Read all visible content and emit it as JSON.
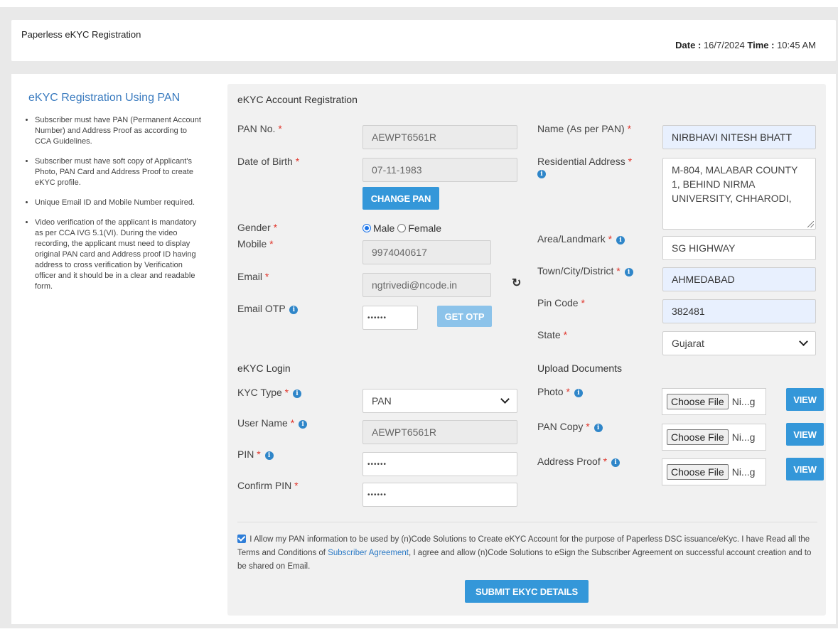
{
  "header": {
    "title": "Paperless eKYC Registration",
    "date_label": "Date :",
    "date_value": "16/7/2024",
    "time_label": "Time :",
    "time_value": "10:45 AM"
  },
  "sidebar": {
    "title": "eKYC Registration Using PAN",
    "items": [
      "Subscriber must have PAN (Permanent Account Number) and Address Proof as according to CCA Guidelines.",
      "Subscriber must have soft copy of Applicant's Photo, PAN Card and Address Proof to create eKYC profile.",
      "Unique Email ID and Mobile Number required.",
      "Video verification of the applicant is mandatory as per CCA IVG 5.1(VI). During the video recording, the applicant must need to display original PAN card and Address proof ID having address to cross verification by Verification officer and it should be in a clear and readable form."
    ]
  },
  "form": {
    "section_title": "eKYC Account Registration",
    "pan_label": "PAN No.",
    "pan_value": "AEWPT6561R",
    "dob_label": "Date of Birth",
    "dob_value": "07-11-1983",
    "change_pan_label": "CHANGE PAN",
    "gender_label": "Gender",
    "gender_options": [
      "Male",
      "Female"
    ],
    "gender_selected": "Male",
    "mobile_label": "Mobile",
    "mobile_value": "9974040617",
    "email_label": "Email",
    "email_value": "ngtrivedi@ncode.in",
    "email_otp_label": "Email OTP",
    "email_otp_value": "••••••",
    "get_otp_label": "GET OTP",
    "name_label": "Name (As per PAN)",
    "name_value": "NIRBHAVI NITESH BHATT",
    "address_label": "Residential Address",
    "address_value": "M-804, MALABAR COUNTY 1, BEHIND NIRMA UNIVERSITY, CHHARODI,",
    "area_label": "Area/Landmark",
    "area_value": "SG HIGHWAY",
    "city_label": "Town/City/District",
    "city_value": "AHMEDABAD",
    "pin_code_label": "Pin Code",
    "pin_code_value": "382481",
    "state_label": "State",
    "state_value": "Gujarat",
    "required_mark": "*"
  },
  "login": {
    "section_title": "eKYC Login",
    "kyc_type_label": "KYC Type",
    "kyc_type_value": "PAN",
    "username_label": "User Name",
    "username_value": "AEWPT6561R",
    "pin_label": "PIN",
    "pin_value": "••••••",
    "confirm_pin_label": "Confirm PIN",
    "confirm_pin_value": "••••••"
  },
  "uploads": {
    "section_title": "Upload Documents",
    "choose_file_label": "Choose File",
    "view_label": "VIEW",
    "items": [
      {
        "label": "Photo",
        "file": "Ni...g"
      },
      {
        "label": "PAN Copy",
        "file": "Ni...g"
      },
      {
        "label": "Address Proof",
        "file": "Ni...g"
      }
    ]
  },
  "agreement": {
    "text_before": "I Allow my PAN information to be used by (n)Code Solutions to Create eKYC Account for the purpose of Paperless DSC issuance/eKyc. I have Read all the Terms and Conditions of",
    "link_text": "Subscriber Agreement",
    "text_after": ", I agree and allow (n)Code Solutions to eSign the Subscriber Agreement on successful account creation and to be shared on Email."
  },
  "submit_label": "SUBMIT EKYC DETAILS",
  "colors": {
    "accent": "#3497d9",
    "required": "#e0342a",
    "link": "#2d7bc6"
  }
}
